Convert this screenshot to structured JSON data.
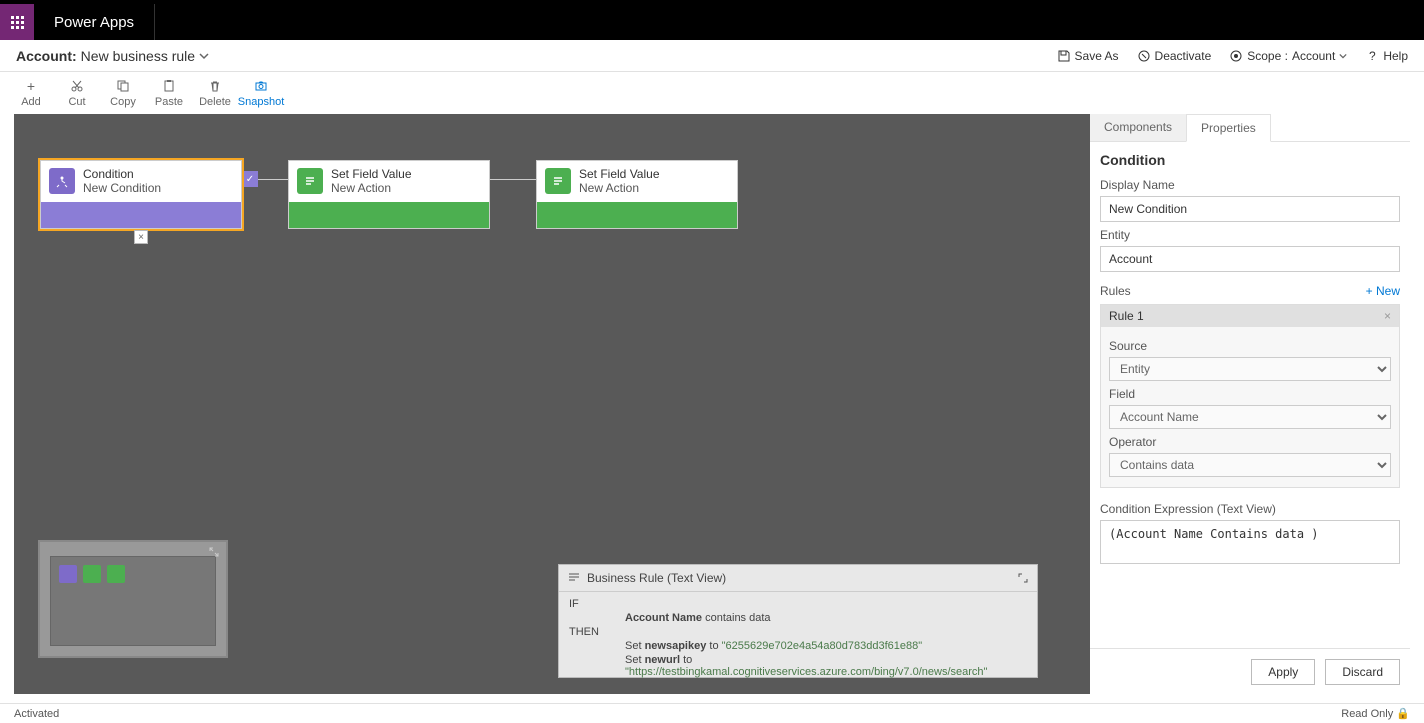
{
  "app": {
    "name": "Power Apps"
  },
  "breadcrumb": {
    "entity": "Account:",
    "rule_name": "New business rule"
  },
  "header_actions": {
    "save_as": "Save As",
    "deactivate": "Deactivate",
    "scope_label": "Scope :",
    "scope_value": "Account",
    "help": "Help"
  },
  "toolbar": {
    "add": "Add",
    "cut": "Cut",
    "copy": "Copy",
    "paste": "Paste",
    "delete": "Delete",
    "snapshot": "Snapshot"
  },
  "canvas": {
    "nodes": [
      {
        "type": "condition",
        "title": "Condition",
        "subtitle": "New Condition"
      },
      {
        "type": "action",
        "title": "Set Field Value",
        "subtitle": "New Action"
      },
      {
        "type": "action",
        "title": "Set Field Value",
        "subtitle": "New Action"
      }
    ]
  },
  "textview": {
    "title": "Business Rule (Text View)",
    "if_kw": "IF",
    "then_kw": "THEN",
    "cond_field": "Account Name",
    "cond_rest": " contains data",
    "set_prefix1": "Set ",
    "set_field1": "newsapikey",
    "set_mid1": " to ",
    "set_val1": "\"6255629e702e4a54a80d783dd3f61e88\"",
    "set_prefix2": "Set ",
    "set_field2": "newurl",
    "set_mid2": " to ",
    "set_val2": "\"https://testbingkamal.cognitiveservices.azure.com/bing/v7.0/news/search\""
  },
  "panel": {
    "tab_components": "Components",
    "tab_properties": "Properties",
    "section": "Condition",
    "display_name_label": "Display Name",
    "display_name": "New Condition",
    "entity_label": "Entity",
    "entity": "Account",
    "rules_label": "Rules",
    "rules_new": "+ New",
    "rule1_title": "Rule 1",
    "source_label": "Source",
    "source_value": "Entity",
    "field_label": "Field",
    "field_value": "Account Name",
    "operator_label": "Operator",
    "operator_value": "Contains data",
    "expr_label": "Condition Expression (Text View)",
    "expr": "(Account Name Contains data )",
    "apply": "Apply",
    "discard": "Discard"
  },
  "status": {
    "activated": "Activated",
    "readonly": "Read Only"
  },
  "glyphs": {
    "plus": "+",
    "close": "×",
    "check": "✓",
    "lock": "🔒"
  }
}
